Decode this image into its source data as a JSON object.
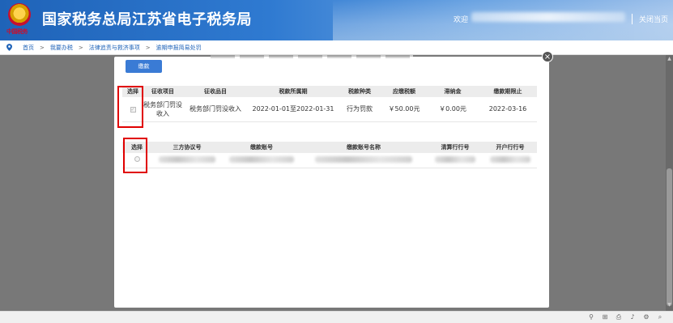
{
  "header": {
    "emblem_text": "中国税务",
    "title": "国家税务总局江苏省电子税务局",
    "welcome": "欢迎",
    "close_page": "关闭当页"
  },
  "breadcrumb": {
    "items": [
      "首页",
      "我要办税",
      "法律追责与救济事项",
      "逾期申报简易处罚"
    ],
    "separator": ">"
  },
  "modal": {
    "pay_button": "缴款",
    "close_icon": "×",
    "tax_table": {
      "headers": [
        "选择",
        "征收项目",
        "征收品目",
        "税款所属期",
        "税款种类",
        "应缴税额",
        "滞纳金",
        "缴款期限止"
      ],
      "rows": [
        [
          "",
          "税务部门罚没收入",
          "税务部门罚没收入",
          "2022-01-01至2022-01-31",
          "行为罚款",
          "￥50.00元",
          "￥0.00元",
          "2022-03-16"
        ]
      ]
    },
    "account_table": {
      "headers": [
        "选择",
        "三方协议号",
        "缴款账号",
        "缴款账号名称",
        "清算行行号",
        "开户行行号"
      ]
    }
  },
  "colors": {
    "header_blue": "#1f63b8",
    "button_blue": "#3a7bd5",
    "highlight_red": "#e00000"
  }
}
